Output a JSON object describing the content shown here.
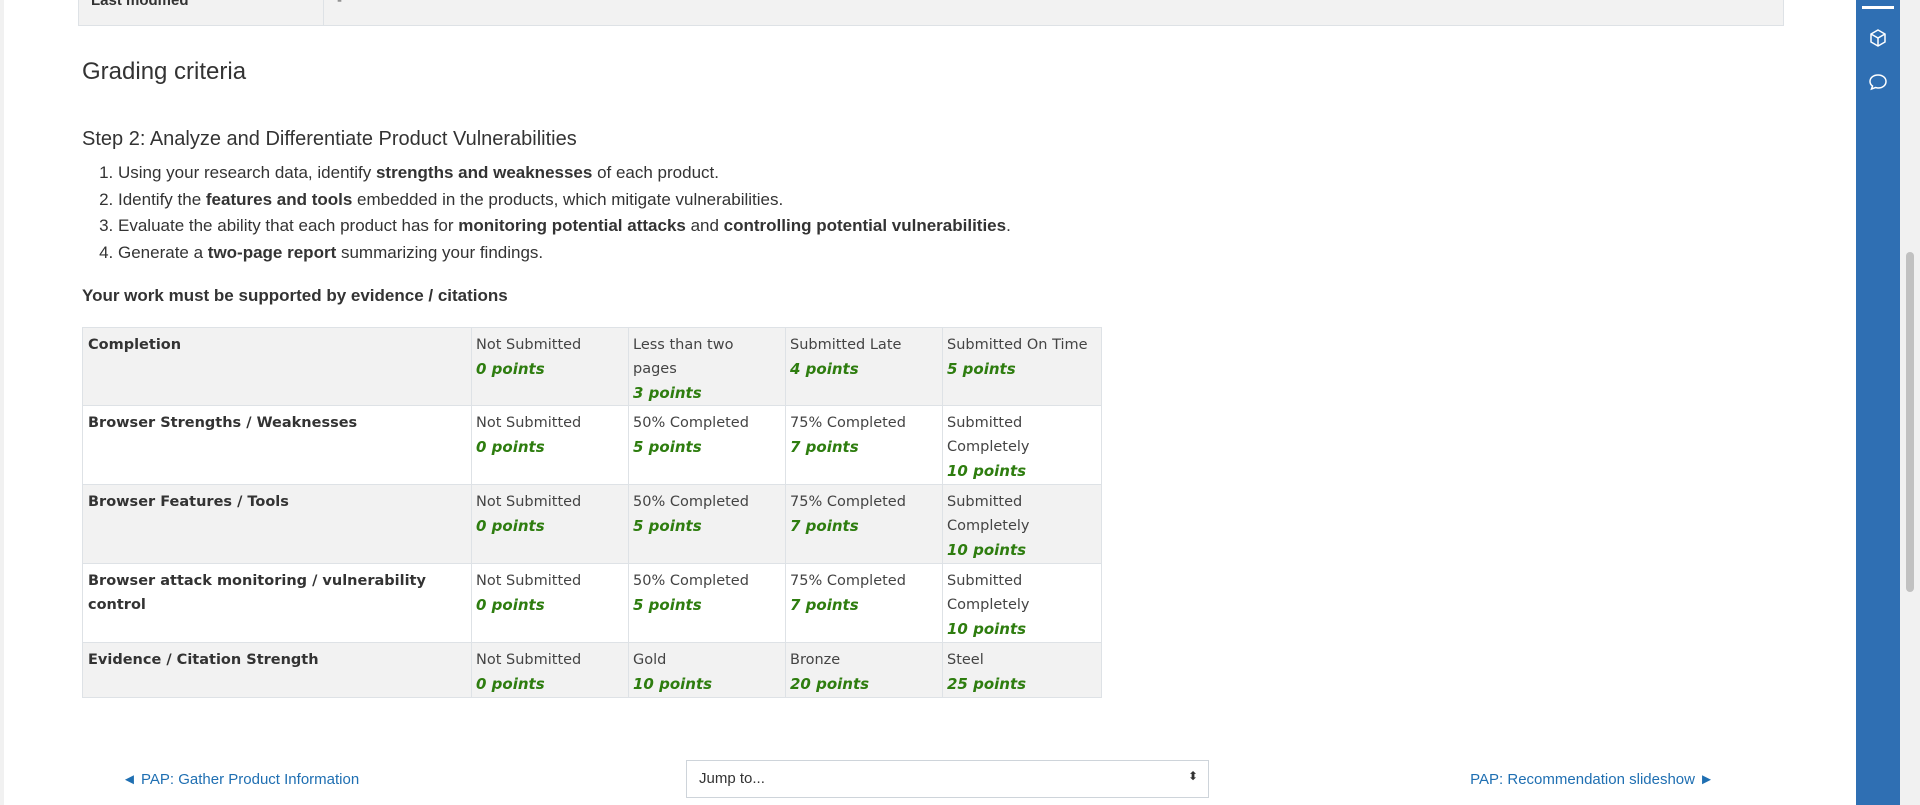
{
  "top_row": {
    "label": "Last modified",
    "value": "-"
  },
  "grading": {
    "heading": "Grading criteria",
    "step_title": "Step 2: Analyze and Differentiate Product Vulnerabilities",
    "steps": [
      {
        "a": "Using your research data, identify ",
        "b": "strengths and weaknesses",
        "c": " of each product."
      },
      {
        "a": "Identify the ",
        "b": "features and tools",
        "c": " embedded in the products, which mitigate vulnerabilities."
      },
      {
        "a": "Evaluate the ability that each product has for ",
        "b": "monitoring potential attacks",
        "c": " and ",
        "d": "controlling potential vulnerabilities",
        "e": "."
      },
      {
        "a": "Generate a ",
        "b": "two-page report",
        "c": " summarizing your findings."
      }
    ],
    "evidence_note": "Your work must be supported by evidence / citations"
  },
  "rubric": [
    {
      "criterion": "Completion",
      "levels": [
        {
          "def": "Not Submitted",
          "points": "0 points"
        },
        {
          "def": "Less than two pages",
          "points": "3 points"
        },
        {
          "def": "Submitted Late",
          "points": "4 points"
        },
        {
          "def": "Submitted On Time",
          "points": "5 points"
        }
      ]
    },
    {
      "criterion": "Browser Strengths / Weaknesses",
      "levels": [
        {
          "def": "Not Submitted",
          "points": "0 points"
        },
        {
          "def": "50% Completed",
          "points": "5 points"
        },
        {
          "def": "75% Completed",
          "points": "7 points"
        },
        {
          "def": "Submitted Completely",
          "points": "10 points"
        }
      ]
    },
    {
      "criterion": "Browser Features / Tools",
      "levels": [
        {
          "def": "Not Submitted",
          "points": "0 points"
        },
        {
          "def": "50% Completed",
          "points": "5 points"
        },
        {
          "def": "75% Completed",
          "points": "7 points"
        },
        {
          "def": "Submitted Completely",
          "points": "10 points"
        }
      ]
    },
    {
      "criterion": "Browser attack monitoring / vulnerability control",
      "levels": [
        {
          "def": "Not Submitted",
          "points": "0 points"
        },
        {
          "def": "50% Completed",
          "points": "5 points"
        },
        {
          "def": "75% Completed",
          "points": "7 points"
        },
        {
          "def": "Submitted Completely",
          "points": "10 points"
        }
      ]
    },
    {
      "criterion": "Evidence / Citation Strength",
      "levels": [
        {
          "def": "Not Submitted",
          "points": "0 points"
        },
        {
          "def": "Gold",
          "points": "10 points"
        },
        {
          "def": "Bronze",
          "points": "20 points"
        },
        {
          "def": "Steel",
          "points": "25 points"
        }
      ]
    }
  ],
  "navigation": {
    "prev_label": "◄ PAP: Gather Product Information",
    "next_label": "PAP: Recommendation slideshow ►",
    "jump_label": "Jump to...",
    "jump_arrow": "⬍"
  },
  "drawer": {
    "icons": [
      "cube-icon",
      "chat-bubble-icon"
    ]
  },
  "colors": {
    "accent": "#2f6fb3",
    "points": "#2e7d0f",
    "link": "#1f6fb2"
  }
}
